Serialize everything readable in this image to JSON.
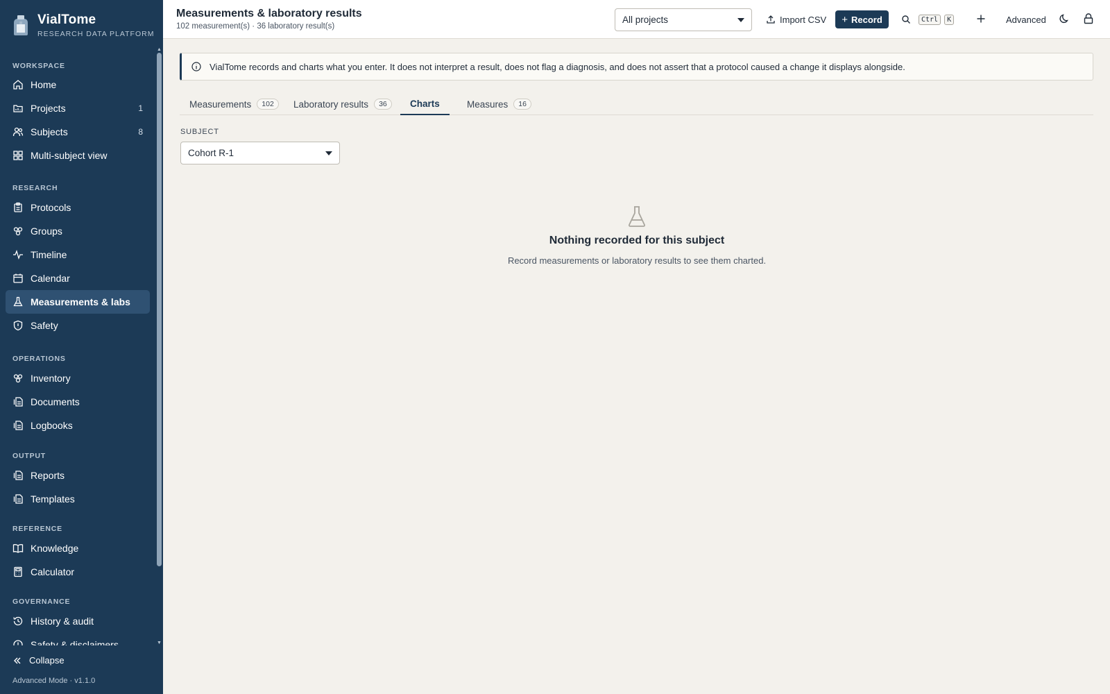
{
  "brand": {
    "name": "VialTome",
    "subtitle": "RESEARCH DATA PLATFORM"
  },
  "sidebar": {
    "sections": [
      {
        "label": "WORKSPACE",
        "items": [
          {
            "label": "Home",
            "icon": "home-icon"
          },
          {
            "label": "Projects",
            "icon": "folder-icon",
            "count": "1"
          },
          {
            "label": "Subjects",
            "icon": "users-icon",
            "count": "8"
          },
          {
            "label": "Multi-subject view",
            "icon": "grid-icon"
          }
        ]
      },
      {
        "label": "RESEARCH",
        "items": [
          {
            "label": "Protocols",
            "icon": "clipboard-icon"
          },
          {
            "label": "Groups",
            "icon": "groups-icon"
          },
          {
            "label": "Timeline",
            "icon": "pulse-icon"
          },
          {
            "label": "Calendar",
            "icon": "calendar-icon"
          },
          {
            "label": "Measurements & labs",
            "icon": "flask-icon",
            "active": true
          },
          {
            "label": "Safety",
            "icon": "shield-icon"
          }
        ]
      },
      {
        "label": "OPERATIONS",
        "items": [
          {
            "label": "Inventory",
            "icon": "boxes-icon"
          },
          {
            "label": "Documents",
            "icon": "documents-icon"
          },
          {
            "label": "Logbooks",
            "icon": "logbook-icon"
          }
        ]
      },
      {
        "label": "OUTPUT",
        "items": [
          {
            "label": "Reports",
            "icon": "report-icon"
          },
          {
            "label": "Templates",
            "icon": "template-icon"
          }
        ]
      },
      {
        "label": "REFERENCE",
        "items": [
          {
            "label": "Knowledge",
            "icon": "book-icon"
          },
          {
            "label": "Calculator",
            "icon": "calculator-icon"
          }
        ]
      },
      {
        "label": "GOVERNANCE",
        "items": [
          {
            "label": "History & audit",
            "icon": "history-icon"
          },
          {
            "label": "Safety & disclaimers",
            "icon": "alert-icon"
          }
        ]
      }
    ],
    "collapse_label": "Collapse",
    "version": "Advanced Mode · v1.1.0"
  },
  "header": {
    "title": "Measurements & laboratory results",
    "subtitle": "102 measurement(s) · 36 laboratory result(s)",
    "project_select": "All projects",
    "import_label": "Import CSV",
    "record_label": "Record",
    "kbd_ctrl": "Ctrl",
    "kbd_k": "K",
    "advanced_label": "Advanced"
  },
  "notice": "VialTome records and charts what you enter. It does not interpret a result, does not flag a diagnosis, and does not assert that a protocol caused a change it displays alongside.",
  "tabs": [
    {
      "label": "Measurements",
      "badge": "102"
    },
    {
      "label": "Laboratory results",
      "badge": "36"
    },
    {
      "label": "Charts",
      "active": true
    },
    {
      "label": "Measures",
      "badge": "16"
    }
  ],
  "subject": {
    "label": "SUBJECT",
    "value": "Cohort R-1"
  },
  "empty_state": {
    "title": "Nothing recorded for this subject",
    "text": "Record measurements or laboratory results to see them charted."
  }
}
